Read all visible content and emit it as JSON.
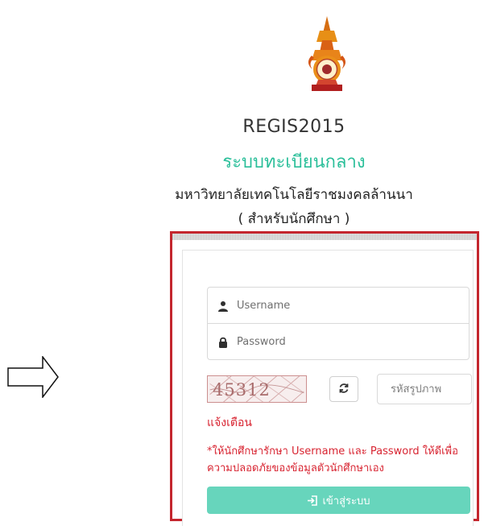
{
  "header": {
    "app_code": "REGIS2015",
    "system_title": "ระบบทะเบียนกลาง",
    "university_name": "มหาวิทยาลัยเทคโนโลยีราชมงคลล้านนา",
    "audience": "( สำหรับนักศึกษา )"
  },
  "login": {
    "username_placeholder": "Username",
    "password_placeholder": "Password",
    "captcha_text": "45312",
    "captcha_placeholder": "รหัสรูปภาพ",
    "warning_title": "แจ้งเตือน",
    "warning_message": "*ให้นักศึกษารักษา Username และ Password ให้ดีเพื่อความปลอดภัยของข้อมูลตัวนักศึกษาเอง",
    "submit_label": "เข้าสู่ระบบ"
  },
  "colors": {
    "accent": "#2bbf9a",
    "button": "#67d5bc",
    "warning": "#d82431",
    "highlight": "#c4262e"
  },
  "icons": {
    "arrow": "right-arrow-icon",
    "user": "user-icon",
    "lock": "lock-icon",
    "refresh": "refresh-icon",
    "login": "sign-in-icon"
  }
}
